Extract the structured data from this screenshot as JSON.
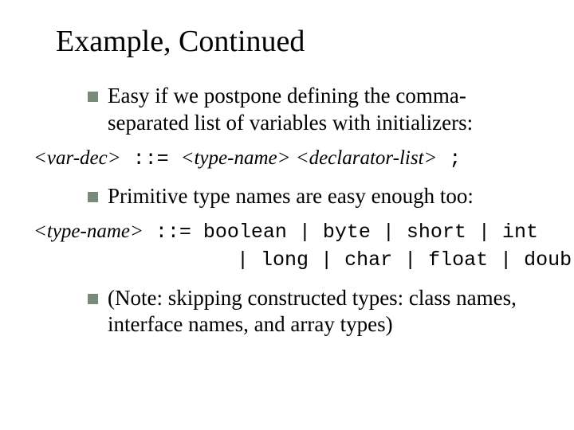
{
  "title": "Example, Continued",
  "bullets": {
    "b1": "Easy if we postpone defining the comma-separated list of variables with initializers:",
    "b2": "Primitive type names are easy enough too:",
    "b3": "(Note: skipping constructed types: class names, interface names, and array types)"
  },
  "grammar1": {
    "lhs": "<var-dec>",
    "op": " ::= ",
    "rhs_a": "<type-name>",
    "sp": " ",
    "rhs_b": "<declarator-list>",
    "tail": " ;"
  },
  "grammar2": {
    "lhs": "<type-name>",
    "op": " ::= ",
    "line1": "boolean | byte | short | int",
    "pad": "                 ",
    "line2": "| long | char | float | double"
  }
}
